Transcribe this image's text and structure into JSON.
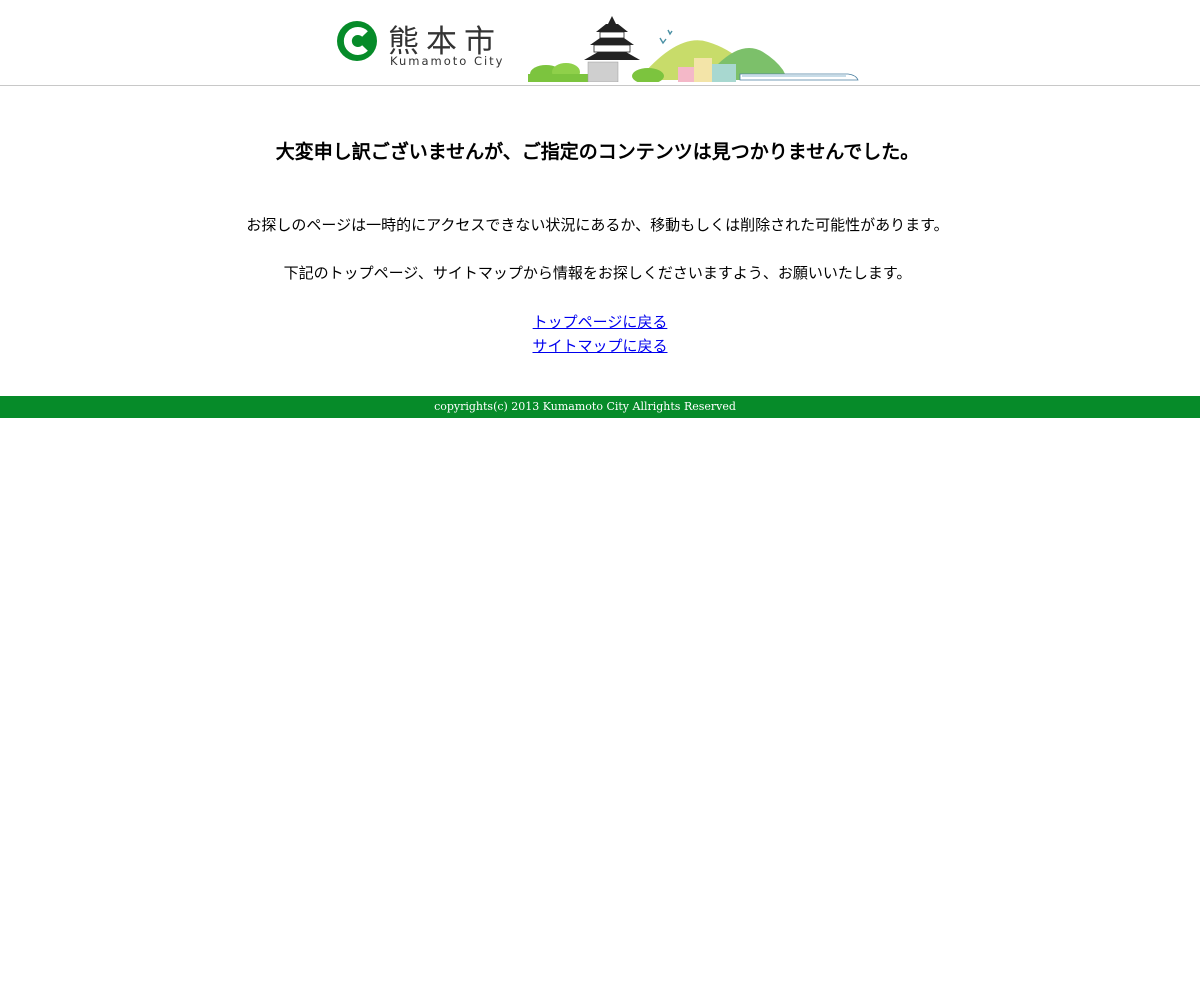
{
  "header": {
    "logo_jp": "熊本市",
    "logo_en": "Kumamoto City",
    "brand_color": "#068b29"
  },
  "main": {
    "heading": "大変申し訳ございませんが、ご指定のコンテンツは見つかりませんでした。",
    "message_1": "お探しのページは一時的にアクセスできない状況にあるか、移動もしくは削除された可能性があります。",
    "message_2": "下記のトップページ、サイトマップから情報をお探しくださいますよう、お願いいたします。",
    "links": {
      "top_page": "トップページに戻る",
      "sitemap": "サイトマップに戻る"
    }
  },
  "footer": {
    "copyright": "copyrights(c) 2013 Kumamoto City Allrights Reserved",
    "background": "#068b29"
  }
}
